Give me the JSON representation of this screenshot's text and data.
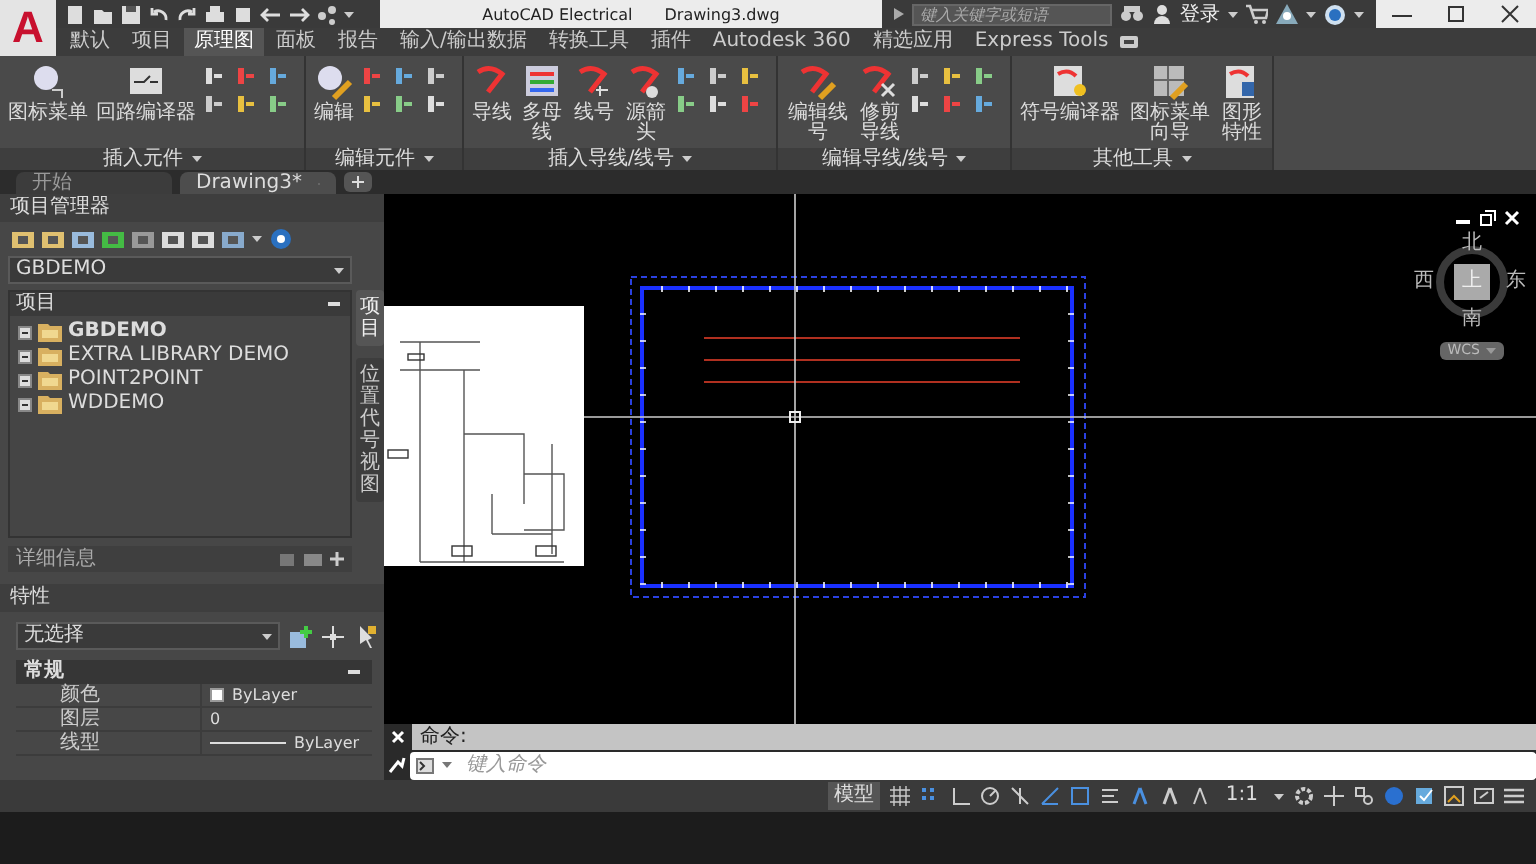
{
  "app_button": {
    "logo": "A"
  },
  "title_bar": {
    "app_name": "AutoCAD Electrical",
    "document": "Drawing3.dwg",
    "search": {
      "placeholder": "键入关键字或短语"
    },
    "sign_in": "登录"
  },
  "ribbon_tabs": [
    {
      "label": "默认",
      "selected": false
    },
    {
      "label": "项目",
      "selected": false
    },
    {
      "label": "原理图",
      "selected": true
    },
    {
      "label": "面板",
      "selected": false
    },
    {
      "label": "报告",
      "selected": false
    },
    {
      "label": "输入/输出数据",
      "selected": false
    },
    {
      "label": "转换工具",
      "selected": false
    },
    {
      "label": "插件",
      "selected": false
    },
    {
      "label": "Autodesk 360",
      "selected": false
    },
    {
      "label": "精选应用",
      "selected": false
    },
    {
      "label": "Express Tools",
      "selected": false
    }
  ],
  "ribbon_groups": [
    {
      "label": "插入元件",
      "small_icons": true,
      "tools": [
        {
          "label": "图标菜单",
          "kind": "single"
        },
        {
          "label": "回路编译器",
          "kind": "single"
        }
      ]
    },
    {
      "label": "编辑元件",
      "small_icons": true,
      "tools": [
        {
          "label": "编辑",
          "kind": "single"
        }
      ]
    },
    {
      "label": "插入导线/线号",
      "small_icons": true,
      "tools": [
        {
          "label": "导线",
          "kind": "single"
        },
        {
          "label": "多母线",
          "kind": "narrow"
        },
        {
          "label": "线号",
          "kind": "narrow"
        },
        {
          "label": "源箭头",
          "kind": "narrow"
        }
      ]
    },
    {
      "label": "编辑导线/线号",
      "small_icons": true,
      "tools": [
        {
          "label": "编辑线号",
          "kind": "medium"
        },
        {
          "label": "修剪导线",
          "kind": "narrow"
        }
      ]
    },
    {
      "label": "其他工具",
      "small_icons": false,
      "tools": [
        {
          "label": "符号编译器",
          "kind": "single"
        },
        {
          "label": "图标菜单向导",
          "kind": "broad"
        },
        {
          "label": "图形特性",
          "kind": "narrow"
        }
      ]
    }
  ],
  "document_tabs": [
    {
      "label": "开始",
      "selected": false
    },
    {
      "label": "Drawing3*",
      "selected": true
    }
  ],
  "project_manager": {
    "title": "项目管理器",
    "project_select": "GBDEMO",
    "tree_header": "项目",
    "projects": [
      {
        "label": "GBDEMO",
        "active": true
      },
      {
        "label": "EXTRA LIBRARY DEMO",
        "active": false
      },
      {
        "label": "POINT2POINT",
        "active": false
      },
      {
        "label": "WDDEMO",
        "active": false
      }
    ],
    "details": "详细信息",
    "side_tabs": [
      {
        "label": "项目",
        "selected": true
      },
      {
        "label": "位置代号视图",
        "selected": false
      }
    ]
  },
  "properties": {
    "title": "特性",
    "selection": "无选择",
    "section": "常规",
    "rows": [
      {
        "label": "颜色",
        "value": "ByLayer",
        "kind": "color"
      },
      {
        "label": "图层",
        "value": "0",
        "kind": "text"
      },
      {
        "label": "线型",
        "value": "ByLayer",
        "kind": "linetype"
      }
    ]
  },
  "viewcube": {
    "north": "北",
    "south": "南",
    "east": "东",
    "west": "西",
    "top": "上",
    "ucs": "WCS"
  },
  "command_line": {
    "history": "命令:",
    "placeholder": "键入命令"
  },
  "status_bar": {
    "model": "模型",
    "scale": "1:1"
  }
}
